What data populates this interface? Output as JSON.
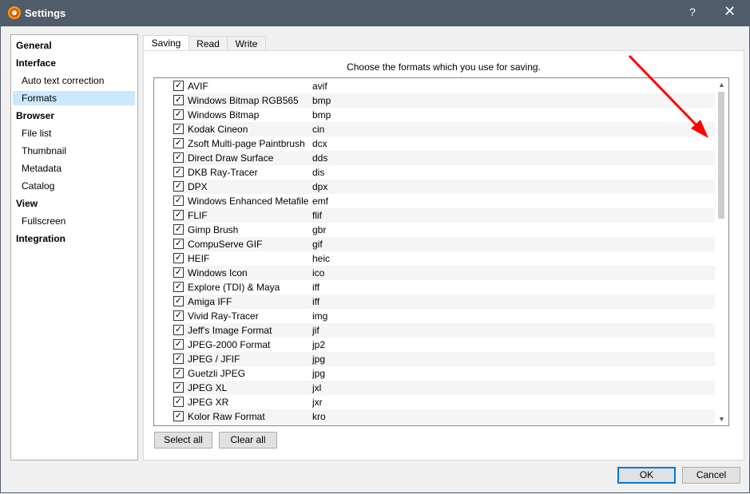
{
  "window": {
    "title": "Settings",
    "help": "?",
    "close": "✕"
  },
  "sidebar": [
    {
      "label": "General",
      "level": 0
    },
    {
      "label": "Interface",
      "level": 0
    },
    {
      "label": "Auto text correction",
      "level": 1
    },
    {
      "label": "Formats",
      "level": 1,
      "selected": true
    },
    {
      "label": "Browser",
      "level": 0
    },
    {
      "label": "File list",
      "level": 1
    },
    {
      "label": "Thumbnail",
      "level": 1
    },
    {
      "label": "Metadata",
      "level": 1
    },
    {
      "label": "Catalog",
      "level": 1
    },
    {
      "label": "View",
      "level": 0
    },
    {
      "label": "Fullscreen",
      "level": 1
    },
    {
      "label": "Integration",
      "level": 0
    }
  ],
  "tabs": [
    {
      "label": "Saving",
      "active": true
    },
    {
      "label": "Read"
    },
    {
      "label": "Write"
    }
  ],
  "hint": "Choose the formats which you use for saving.",
  "formats": [
    {
      "name": "AVIF",
      "ext": "avif"
    },
    {
      "name": "Windows Bitmap RGB565",
      "ext": "bmp"
    },
    {
      "name": "Windows Bitmap",
      "ext": "bmp"
    },
    {
      "name": "Kodak Cineon",
      "ext": "cin"
    },
    {
      "name": "Zsoft Multi-page Paintbrush",
      "ext": "dcx"
    },
    {
      "name": "Direct Draw Surface",
      "ext": "dds"
    },
    {
      "name": "DKB Ray-Tracer",
      "ext": "dis"
    },
    {
      "name": "DPX",
      "ext": "dpx"
    },
    {
      "name": "Windows Enhanced Metafile",
      "ext": "emf"
    },
    {
      "name": "FLIF",
      "ext": "flif"
    },
    {
      "name": "Gimp Brush",
      "ext": "gbr"
    },
    {
      "name": "CompuServe GIF",
      "ext": "gif"
    },
    {
      "name": "HEIF",
      "ext": "heic"
    },
    {
      "name": "Windows Icon",
      "ext": "ico"
    },
    {
      "name": "Explore (TDI) & Maya",
      "ext": "iff"
    },
    {
      "name": "Amiga IFF",
      "ext": "iff"
    },
    {
      "name": "Vivid Ray-Tracer",
      "ext": "img"
    },
    {
      "name": "Jeff's Image Format",
      "ext": "jif"
    },
    {
      "name": "JPEG-2000 Format",
      "ext": "jp2"
    },
    {
      "name": "JPEG / JFIF",
      "ext": "jpg"
    },
    {
      "name": "Guetzli JPEG",
      "ext": "jpg"
    },
    {
      "name": "JPEG XL",
      "ext": "jxl"
    },
    {
      "name": "JPEG XR",
      "ext": "jxr"
    },
    {
      "name": "Kolor Raw Format",
      "ext": "kro"
    }
  ],
  "buttons": {
    "select_all": "Select all",
    "clear_all": "Clear all",
    "ok": "OK",
    "cancel": "Cancel"
  },
  "colors": {
    "titlebar": "#515c6b",
    "selection": "#cce8ff",
    "annotation_arrow": "#ff0000"
  }
}
